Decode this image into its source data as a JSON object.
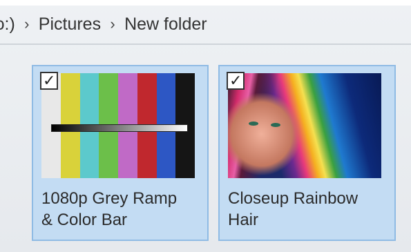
{
  "breadcrumb": {
    "drive_fragment": "ɔ:)",
    "separator": "›",
    "items": [
      "Pictures",
      "New folder"
    ]
  },
  "files": [
    {
      "name_line1": "1080p Grey Ramp",
      "name_line2": "& Color Bar",
      "selected": true,
      "checkbox_mark": "✓",
      "thumbnail": "color-bars",
      "bar_colors": [
        "#e8e8e8",
        "#d9d23a",
        "#5cc9cc",
        "#6cbf4a",
        "#c06ac6",
        "#c0282e",
        "#2d57c4",
        "#151515"
      ]
    },
    {
      "name_line1": "Closeup Rainbow",
      "name_line2": "Hair",
      "selected": true,
      "checkbox_mark": "✓",
      "thumbnail": "rainbow-hair-photo"
    }
  ],
  "colors": {
    "selection_fill": "#c3dcf3",
    "selection_border": "#8fbbe4",
    "background": "#e9ecef"
  }
}
